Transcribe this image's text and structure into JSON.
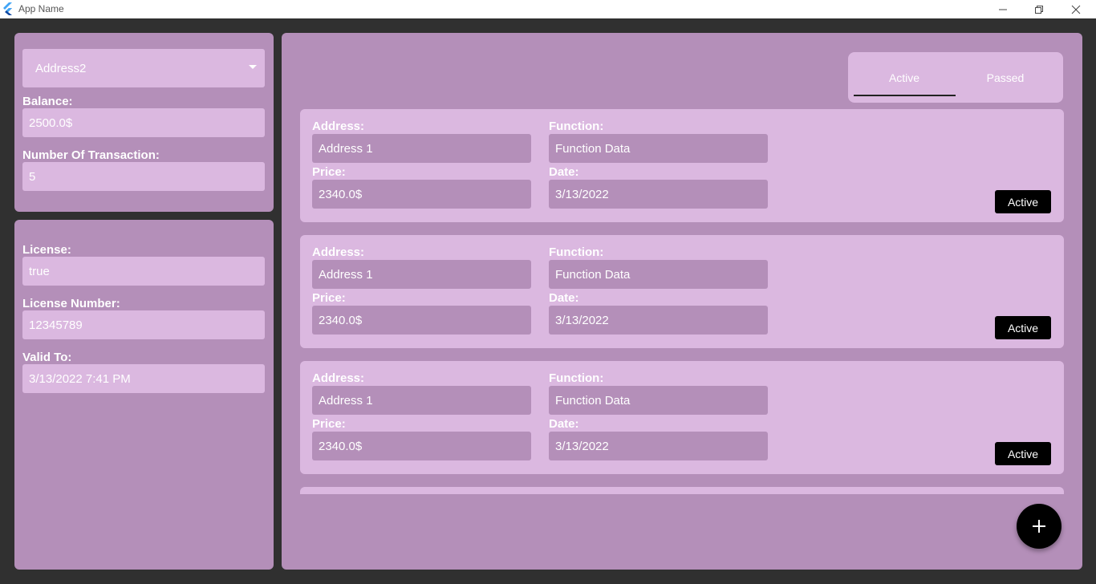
{
  "window": {
    "title": "App Name"
  },
  "account": {
    "selected_address": "Address2",
    "balance_label": "Balance:",
    "balance_value": "2500.0$",
    "transactions_label": "Number Of Transaction:",
    "transactions_value": "5"
  },
  "license": {
    "license_label": "License:",
    "license_value": "true",
    "number_label": "License Number:",
    "number_value": "12345789",
    "valid_label": "Valid To:",
    "valid_value": "3/13/2022 7:41 PM"
  },
  "tabs": [
    {
      "label": "Active",
      "selected": true
    },
    {
      "label": "Passed",
      "selected": false
    }
  ],
  "labels": {
    "address": "Address:",
    "function": "Function:",
    "price": "Price:",
    "date": "Date:"
  },
  "transactions": [
    {
      "address": "Address 1",
      "function": "Function Data",
      "price": "2340.0$",
      "date": "3/13/2022",
      "status": "Active"
    },
    {
      "address": "Address 1",
      "function": "Function Data",
      "price": "2340.0$",
      "date": "3/13/2022",
      "status": "Active"
    },
    {
      "address": "Address 1",
      "function": "Function Data",
      "price": "2340.0$",
      "date": "3/13/2022",
      "status": "Active"
    }
  ],
  "icons": {
    "app": "flutter-logo-icon",
    "minimize": "minimize-icon",
    "maximize": "restore-icon",
    "close": "close-icon",
    "dropdown": "caret-down-icon",
    "add": "plus-icon"
  },
  "colors": {
    "panel": "#b48fb9",
    "field": "#dbb8e0",
    "background": "#303030",
    "status_badge": "#000000"
  }
}
